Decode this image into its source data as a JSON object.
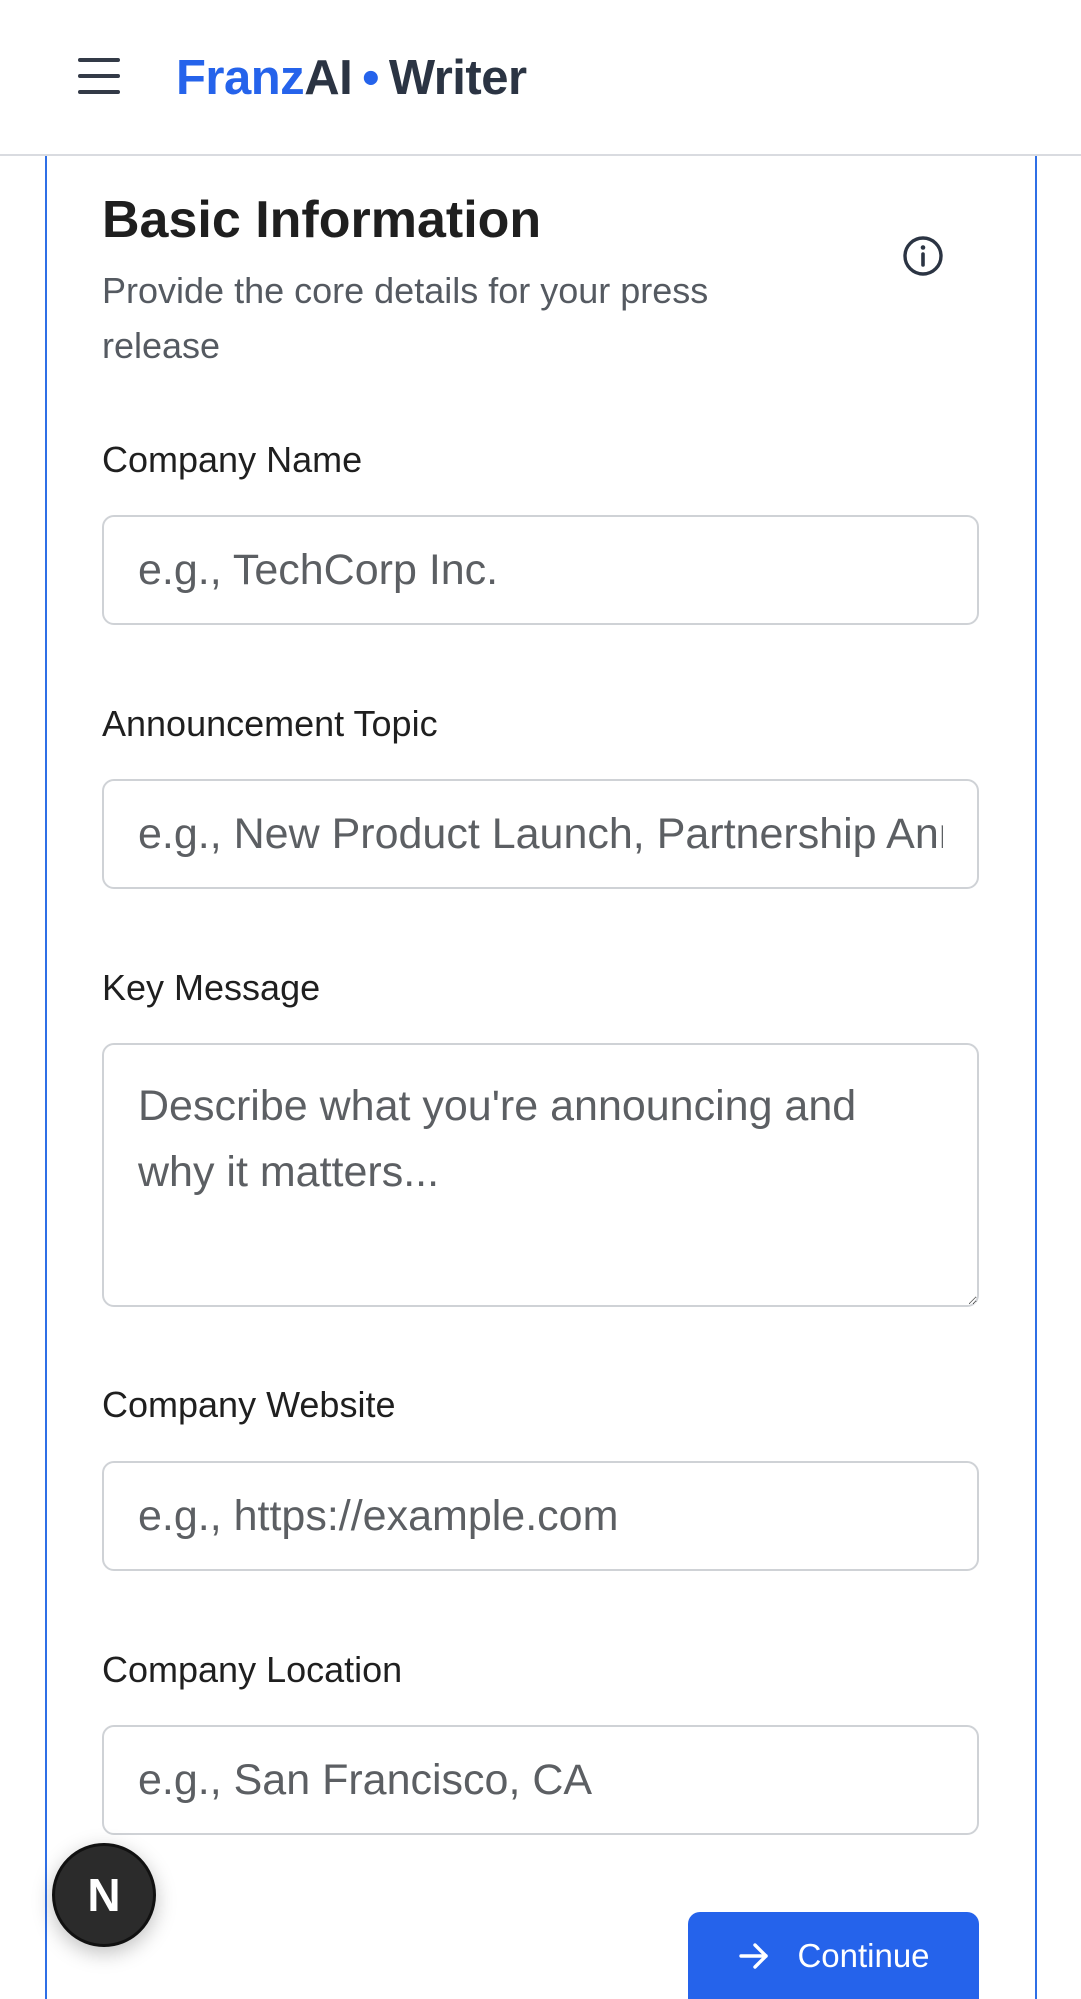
{
  "header": {
    "brand_part1": "Franz",
    "brand_part2": "AI",
    "brand_separator": "•",
    "brand_part3": "Writer"
  },
  "section": {
    "title": "Basic Information",
    "subtitle": "Provide the core details for your press release"
  },
  "fields": {
    "company_name": {
      "label": "Company Name",
      "placeholder": "e.g., TechCorp Inc."
    },
    "announcement_topic": {
      "label": "Announcement Topic",
      "placeholder": "e.g., New Product Launch, Partnership Announcement"
    },
    "key_message": {
      "label": "Key Message",
      "placeholder": "Describe what you're announcing and why it matters..."
    },
    "company_website": {
      "label": "Company Website",
      "placeholder": "e.g., https://example.com"
    },
    "company_location": {
      "label": "Company Location",
      "placeholder": "e.g., San Francisco, CA"
    }
  },
  "actions": {
    "continue_label": "Continue"
  },
  "badge": {
    "letter": "N"
  },
  "colors": {
    "accent": "#2563eb",
    "brand_dark": "#2b3443",
    "border": "#cfd2d6"
  },
  "icons": {
    "menu": "hamburger-menu-icon",
    "info": "info-icon",
    "arrow": "arrow-right-icon"
  }
}
